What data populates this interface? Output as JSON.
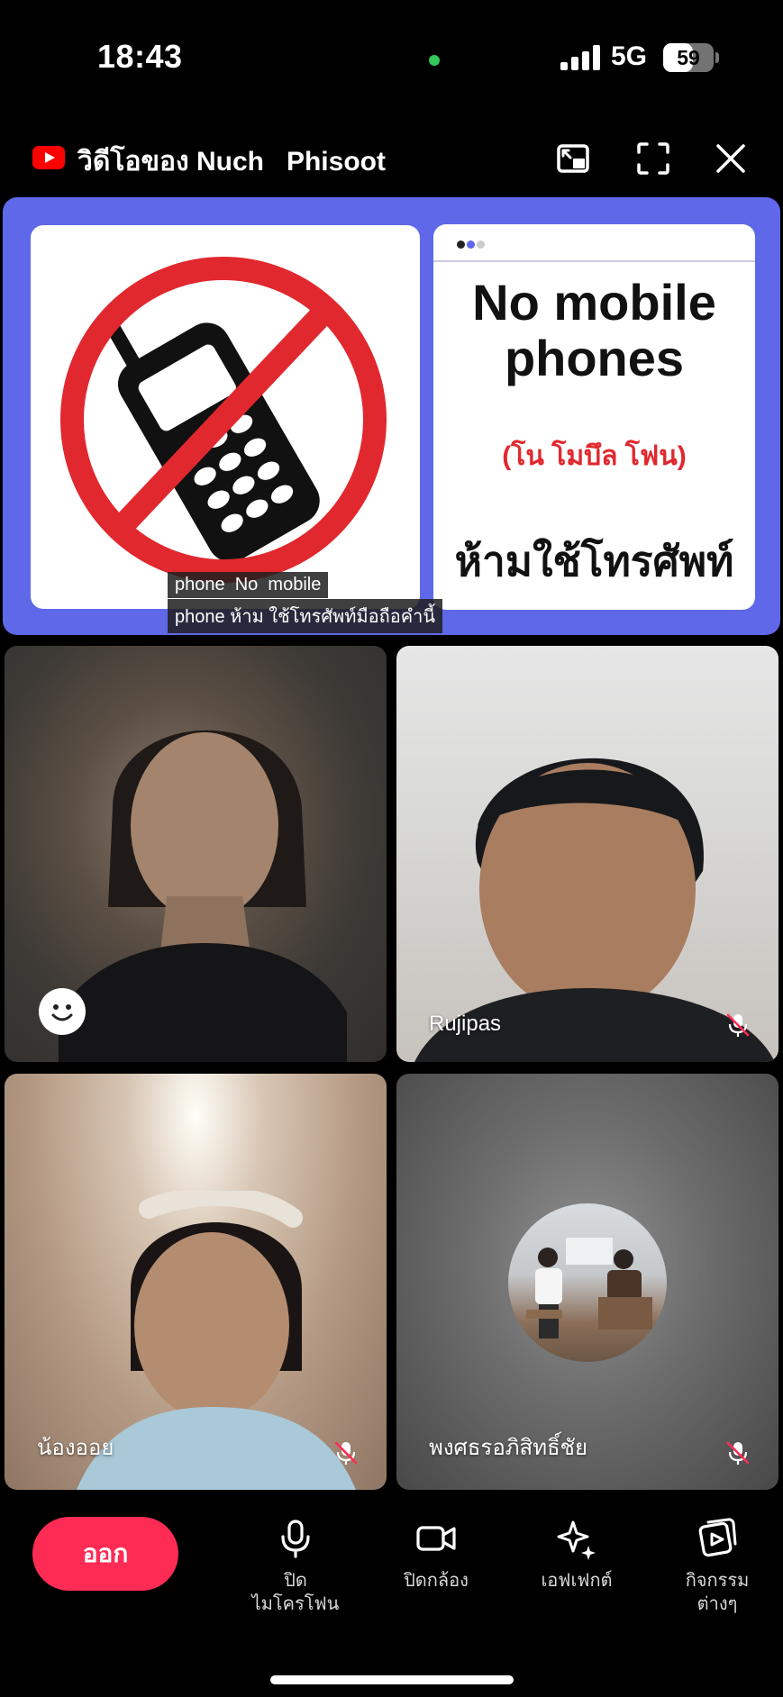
{
  "status_bar": {
    "time": "18:43",
    "network": "5G",
    "battery": "59",
    "battery_level": 0.59
  },
  "header": {
    "title": "วิดีโอของ Nuch   Phisoot",
    "icons": [
      "youtube-icon",
      "picture-in-picture-icon",
      "fullscreen-icon",
      "close-icon"
    ]
  },
  "shared_screen": {
    "sign_title": "No mobile phones",
    "sign_pronunciation": "(โน โมบึล โฟน)",
    "sign_thai": "ห้ามใช้โทรศัพท์",
    "caption_line1": "phone  No  mobile",
    "caption_line2": "phone ห้าม ใช้โทรศัพท์มือถือคำนี้"
  },
  "participants": [
    {
      "name": "",
      "muted": false,
      "reaction_button": true
    },
    {
      "name": "Rujipas",
      "muted": true
    },
    {
      "name": "น้องออย",
      "muted": true
    },
    {
      "name": "พงศธรอภิสิทธิ์ชัย",
      "muted": true,
      "avatar": true
    }
  ],
  "bottom_bar": {
    "leave": "ออก",
    "mic": "ปิด\nไมโครโฟน",
    "camera": "ปิดกล้อง",
    "effects": "เอฟเฟกต์",
    "activities": "กิจกรรม\nต่างๆ"
  },
  "colors": {
    "accent": "#fe2c55",
    "shared_bg": "#5f68e8",
    "prohibit_red": "#e0282e"
  }
}
